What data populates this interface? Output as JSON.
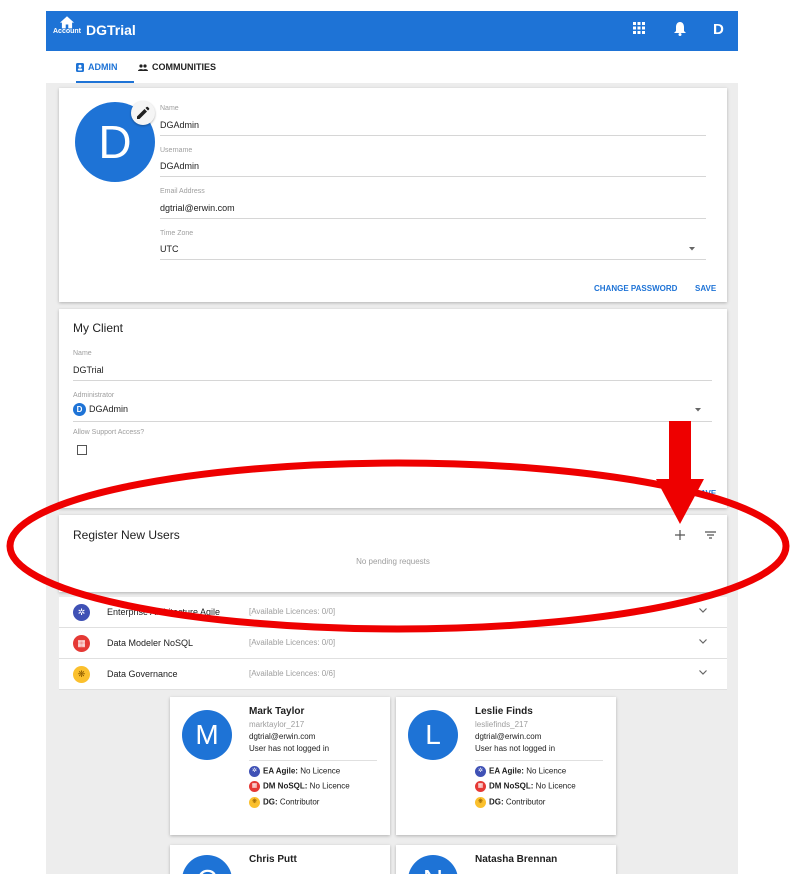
{
  "appbar": {
    "home_label": "Account",
    "title": "DGTrial",
    "user_initial": "D"
  },
  "tabs": [
    {
      "label": "ADMIN"
    },
    {
      "label": "COMMUNITIES"
    }
  ],
  "profile": {
    "avatar_initial": "D",
    "name_label": "Name",
    "name": "DGAdmin",
    "username_label": "Username",
    "username": "DGAdmin",
    "email_label": "Email Address",
    "email": "dgtrial@erwin.com",
    "timezone_label": "Time Zone",
    "timezone": "UTC",
    "change_password": "CHANGE PASSWORD",
    "save": "SAVE"
  },
  "client": {
    "title": "My Client",
    "name_label": "Name",
    "name": "DGTrial",
    "admin_label": "Administrator",
    "admin_initial": "D",
    "admin": "DGAdmin",
    "support_label": "Allow Support Access?",
    "save": "SAVE"
  },
  "register": {
    "title": "Register New Users",
    "empty": "No pending requests"
  },
  "licences": [
    {
      "name": "Enterprise Architecture Agile",
      "available": "[Available Licences: 0/0]",
      "color": "#3f51b5",
      "icon": "ea-icon"
    },
    {
      "name": "Data Modeler NoSQL",
      "available": "[Available Licences: 0/0]",
      "color": "#e53935",
      "icon": "dm-icon"
    },
    {
      "name": "Data Governance",
      "available": "[Available Licences: 0/6]",
      "color": "#fbc02d",
      "icon": "dg-icon"
    }
  ],
  "users": [
    {
      "initial": "M",
      "name": "Mark Taylor",
      "handle": "marktaylor_217",
      "email": "dgtrial@erwin.com",
      "status": "User has not logged in",
      "lic": [
        {
          "k": "EA Agile:",
          "v": " No Licence"
        },
        {
          "k": "DM NoSQL:",
          "v": " No Licence"
        },
        {
          "k": "DG:",
          "v": " Contributor"
        }
      ]
    },
    {
      "initial": "L",
      "name": "Leslie Finds",
      "handle": "lesliefinds_217",
      "email": "dgtrial@erwin.com",
      "status": "User has not logged in",
      "lic": [
        {
          "k": "EA Agile:",
          "v": " No Licence"
        },
        {
          "k": "DM NoSQL:",
          "v": " No Licence"
        },
        {
          "k": "DG:",
          "v": " Contributor"
        }
      ]
    },
    {
      "initial": "C",
      "name": "Chris Putt"
    },
    {
      "initial": "N",
      "name": "Natasha Brennan"
    }
  ],
  "colors": {
    "accent": "#1e73d6",
    "annotation": "#ee0000"
  }
}
